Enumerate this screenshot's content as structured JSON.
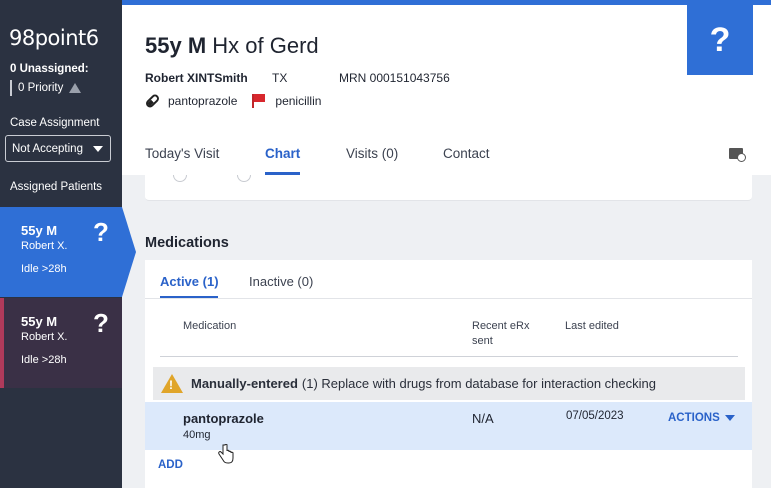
{
  "sidebar": {
    "brand": "98point6",
    "unassigned": "0 Unassigned:",
    "priority": "0 Priority",
    "case_assignment_label": "Case Assignment",
    "case_assignment_value": "Not Accepting",
    "assigned_patients_label": "Assigned Patients",
    "patients": [
      {
        "age_sex": "55y M",
        "name": "Robert X.",
        "status": "Idle >28h",
        "icon": "question-icon"
      },
      {
        "age_sex": "55y M",
        "name": "Robert X.",
        "status": "Idle >28h",
        "icon": "question-icon"
      }
    ]
  },
  "header": {
    "age_sex": "55y M",
    "complaint": "Hx of Gerd",
    "patient_name": "Robert XINTSmith",
    "state": "TX",
    "mrn": "MRN 000151043756",
    "medication_tag": "pantoprazole",
    "allergy_tag": "penicillin",
    "help_symbol": "?"
  },
  "tabs": [
    {
      "label": "Today's Visit",
      "active": false
    },
    {
      "label": "Chart",
      "active": true
    },
    {
      "label": "Visits (0)",
      "active": false
    },
    {
      "label": "Contact",
      "active": false
    }
  ],
  "medications": {
    "title": "Medications",
    "subtabs": [
      {
        "label": "Active (1)",
        "active": true
      },
      {
        "label": "Inactive (0)",
        "active": false
      }
    ],
    "columns": {
      "medication": "Medication",
      "recent_erx_line1": "Recent eRx",
      "recent_erx_line2": "sent",
      "last_edited": "Last edited"
    },
    "warning": {
      "bold": "Manually-entered",
      "text": "(1) Replace with drugs from database for interaction checking"
    },
    "rows": [
      {
        "name": "pantoprazole",
        "dose": "40mg",
        "erx": "N/A",
        "last_edited": "07/05/2023",
        "actions_label": "ACTIONS"
      }
    ],
    "add_label": "ADD"
  },
  "colors": {
    "accent": "#2f6fd6",
    "sidebar_bg": "#2b3241",
    "allergy_flag": "#d8272d",
    "warning": "#e0a52a"
  }
}
